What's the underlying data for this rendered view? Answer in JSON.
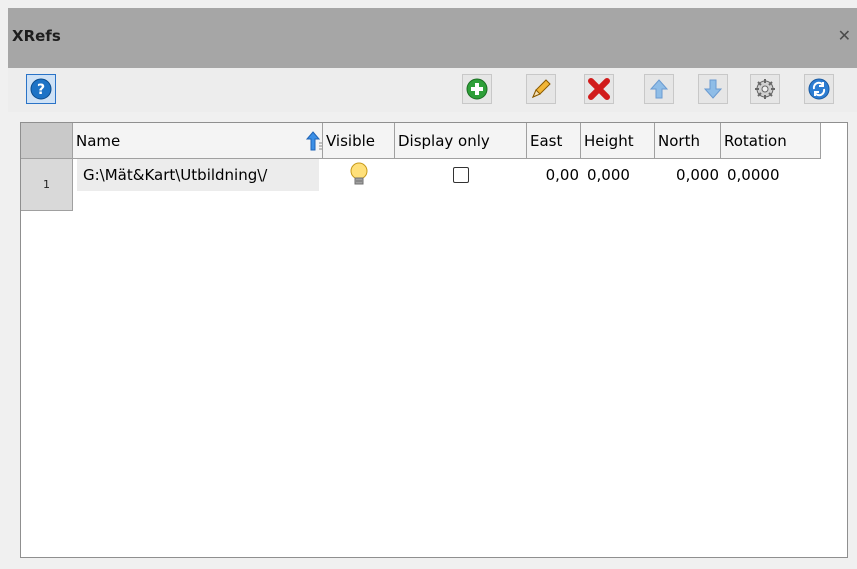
{
  "panel": {
    "title": "XRefs"
  },
  "toolbar": {
    "help": "help-icon",
    "add": "add-icon",
    "edit": "pencil-icon",
    "delete": "delete-icon",
    "up": "arrow-up-icon",
    "down": "arrow-down-icon",
    "settings": "settings-icon",
    "refresh": "refresh-icon"
  },
  "grid": {
    "columns": [
      "Name",
      "Visible",
      "Display only",
      "East",
      "Height",
      "North",
      "Rotation"
    ],
    "rows": [
      {
        "index": "1",
        "name": "G:\\Mät&Kart\\Utbildning\\/",
        "visible": "lightbulb-icon",
        "display_only": false,
        "east": "0,00",
        "height": "0,000",
        "north": "0,000",
        "rotation": "0,0000"
      }
    ]
  }
}
